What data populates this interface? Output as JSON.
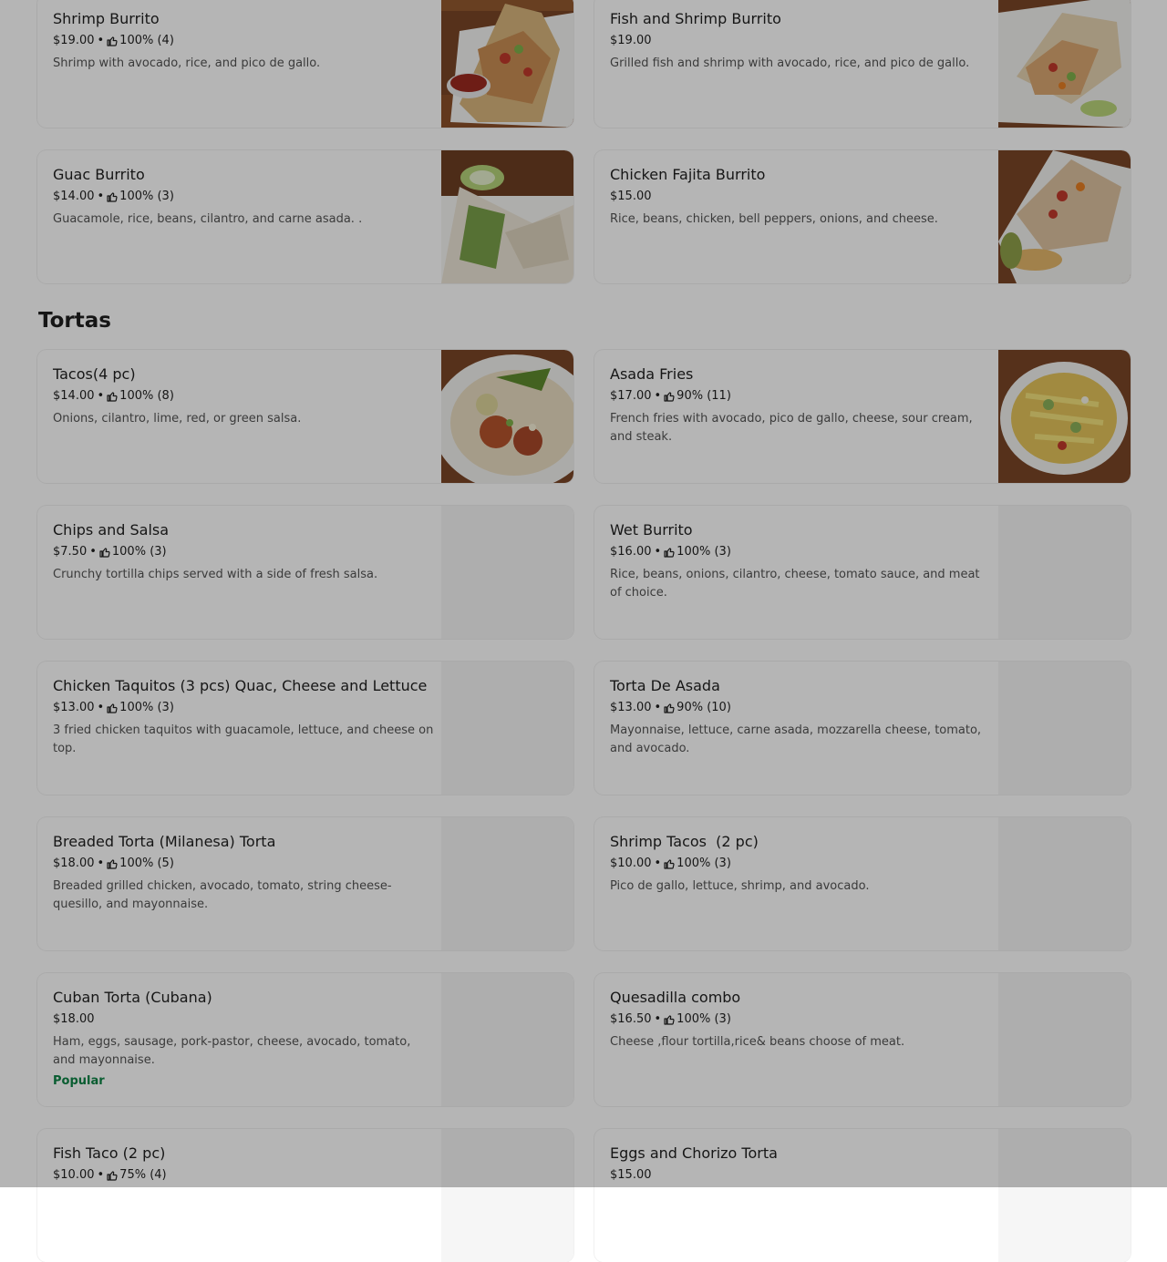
{
  "section": {
    "title": "Tortas"
  },
  "popular_label": "Popular",
  "separator": "•",
  "items": [
    {
      "name": "Shrimp Burrito",
      "price": "$19.00",
      "rating": "100% (4)",
      "desc": "Shrimp with avocado, rice, and pico de gallo."
    },
    {
      "name": "Fish and Shrimp Burrito",
      "price": "$19.00",
      "rating": "",
      "desc": "Grilled fish and shrimp with avocado, rice, and pico de gallo."
    },
    {
      "name": "Guac Burrito",
      "price": "$14.00",
      "rating": "100% (3)",
      "desc": "Guacamole, rice, beans, cilantro, and carne asada. ."
    },
    {
      "name": "Chicken Fajita Burrito",
      "price": "$15.00",
      "rating": "",
      "desc": "Rice, beans, chicken, bell peppers, onions, and cheese."
    },
    {
      "name": "Tacos(4 pc)",
      "price": "$14.00",
      "rating": "100% (8)",
      "desc": "Onions, cilantro, lime, red, or green salsa."
    },
    {
      "name": "Asada Fries",
      "price": "$17.00",
      "rating": "90% (11)",
      "desc": "French fries with avocado, pico de gallo, cheese, sour cream, and steak."
    },
    {
      "name": "Chips and Salsa",
      "price": "$7.50",
      "rating": "100% (3)",
      "desc": "Crunchy tortilla chips served with a side of fresh salsa."
    },
    {
      "name": "Wet Burrito",
      "price": "$16.00",
      "rating": "100% (3)",
      "desc": "Rice, beans, onions, cilantro, cheese, tomato sauce, and meat of choice."
    },
    {
      "name": "Chicken Taquitos (3 pcs) Quac, Cheese and Lettuce",
      "price": "$13.00",
      "rating": "100% (3)",
      "desc": "3 fried chicken taquitos with guacamole, lettuce, and cheese on top."
    },
    {
      "name": "Torta De Asada",
      "price": "$13.00",
      "rating": "90% (10)",
      "desc": "Mayonnaise, lettuce, carne asada, mozzarella cheese, tomato, and avocado."
    },
    {
      "name": "Breaded Torta (Milanesa) Torta",
      "price": "$18.00",
      "rating": "100% (5)",
      "desc": "Breaded grilled chicken, avocado, tomato, string cheese-quesillo, and mayonnaise."
    },
    {
      "name": "Shrimp Tacos  (2 pc)",
      "price": "$10.00",
      "rating": "100% (3)",
      "desc": "Pico de gallo, lettuce, shrimp, and avocado."
    },
    {
      "name": "Cuban Torta (Cubana)",
      "price": "$18.00",
      "rating": "",
      "desc": "Ham, eggs, sausage, pork-pastor, cheese, avocado, tomato, and mayonnaise."
    },
    {
      "name": "Quesadilla combo",
      "price": "$16.50",
      "rating": "100% (3)",
      "desc": "Cheese ,flour tortilla,rice& beans choose of meat."
    },
    {
      "name": "Fish Taco (2 pc)",
      "price": "$10.00",
      "rating": "75% (4)",
      "desc": ""
    },
    {
      "name": "Eggs and Chorizo Torta",
      "price": "$15.00",
      "rating": "",
      "desc": ""
    }
  ],
  "colors": {
    "overlay": "rgba(0,0,0,0.29)",
    "popular": "#0e8345",
    "text": "#1f1f1f",
    "muted": "#545454"
  },
  "icons": {
    "rating": "thumbs-up-icon"
  }
}
